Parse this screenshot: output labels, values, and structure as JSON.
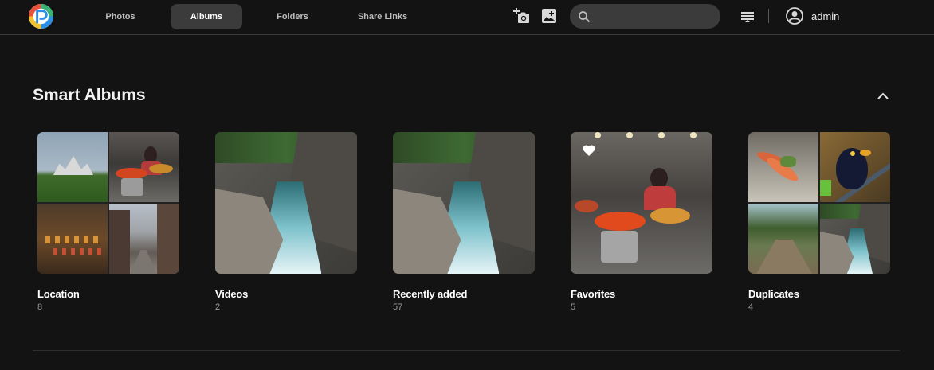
{
  "header": {
    "logo": "photoprism-logo",
    "tabs": [
      {
        "label": "Photos",
        "active": false
      },
      {
        "label": "Albums",
        "active": true
      },
      {
        "label": "Folders",
        "active": false
      },
      {
        "label": "Share Links",
        "active": false
      }
    ],
    "icons": {
      "add_photo": "add-photo-icon",
      "add_album": "add-album-icon",
      "search": "search-icon",
      "sort": "sort-icon",
      "user": "account-circle-icon"
    },
    "search": {
      "value": "",
      "placeholder": ""
    },
    "user": {
      "name": "admin"
    }
  },
  "section": {
    "title": "Smart Albums",
    "collapse_icon": "chevron-up-icon",
    "albums": [
      {
        "name": "Location",
        "count": "8"
      },
      {
        "name": "Videos",
        "count": "2"
      },
      {
        "name": "Recently added",
        "count": "57"
      },
      {
        "name": "Favorites",
        "count": "5",
        "badge_icon": "heart-icon"
      },
      {
        "name": "Duplicates",
        "count": "4"
      }
    ]
  },
  "colors": {
    "background": "#131313",
    "active_tab": "#3b3b3b",
    "search_bg": "#3b3b3b",
    "muted_text": "#9a9a9a"
  }
}
